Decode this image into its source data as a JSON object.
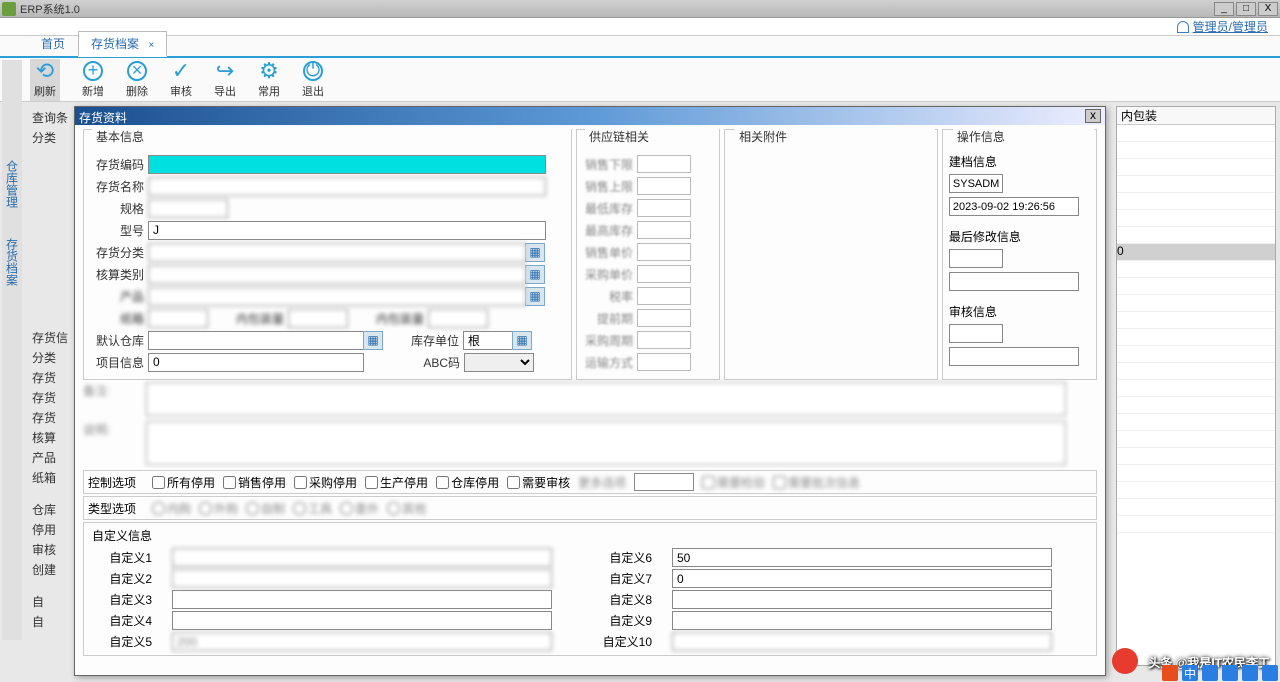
{
  "app": {
    "title": "ERP系统1.0"
  },
  "user": {
    "display": "管理员/管理员"
  },
  "tabs": {
    "home": "首页",
    "archive": "存货档案"
  },
  "toolbar": {
    "refresh": "刷新",
    "add": "新增",
    "delete": "删除",
    "audit": "审核",
    "export": "导出",
    "common": "常用",
    "exit": "退出"
  },
  "left_nav": {
    "warehouse": "仓库管理",
    "archive": "存货档案"
  },
  "bg": {
    "query": "查询条",
    "category": "分类",
    "inventory": "存货信",
    "cat2": "分类",
    "inv2": "存货",
    "inv3": "存货",
    "inv4": "存货",
    "acct": "核算",
    "prod": "产品",
    "box": "纸箱",
    "wh": "仓库",
    "stop": "停用",
    "aud": "审核",
    "create": "创建",
    "auto": "自",
    "auto2": "自"
  },
  "right_grid": {
    "header": "内包装"
  },
  "modal": {
    "title": "存货资料",
    "sections": {
      "basic": "基本信息",
      "supply": "供应链相关",
      "attach": "相关附件",
      "ops": "操作信息"
    },
    "fields": {
      "code": "存货编码",
      "name": "存货名称",
      "spec": "规格",
      "model": "型号",
      "cat": "存货分类",
      "acct_type": "核算类别",
      "default_wh": "默认仓库",
      "project": "项目信息",
      "stock_unit": "库存单位",
      "abc": "ABC码"
    },
    "values": {
      "code": "",
      "name": "",
      "spec": "",
      "model": "J",
      "cat": "",
      "acct_type": "",
      "default_wh": "",
      "project": "0",
      "stock_unit": "根",
      "abc": ""
    },
    "ops": {
      "create_info": "建档信息",
      "create_user": "SYSADM",
      "create_time": "2023-09-02 19:26:56",
      "last_mod": "最后修改信息",
      "last_mod_user": "",
      "last_mod_time": "",
      "audit": "审核信息",
      "audit_user": "",
      "audit_time": ""
    },
    "control": {
      "label": "控制选项",
      "all_stop": "所有停用",
      "sale_stop": "销售停用",
      "purchase_stop": "采购停用",
      "prod_stop": "生产停用",
      "wh_stop": "仓库停用",
      "need_audit": "需要审核"
    },
    "type_opts": {
      "label": "类型选项"
    },
    "custom": {
      "label": "自定义信息",
      "c1": "自定义1",
      "c2": "自定义2",
      "c3": "自定义3",
      "c4": "自定义4",
      "c5": "自定义5",
      "c6": "自定义6",
      "c7": "自定义7",
      "c8": "自定义8",
      "c9": "自定义9",
      "c10": "自定义10",
      "v5": "200",
      "v6": "50",
      "v7": "0"
    }
  },
  "watermark": "头条 @我是IT农民李工"
}
